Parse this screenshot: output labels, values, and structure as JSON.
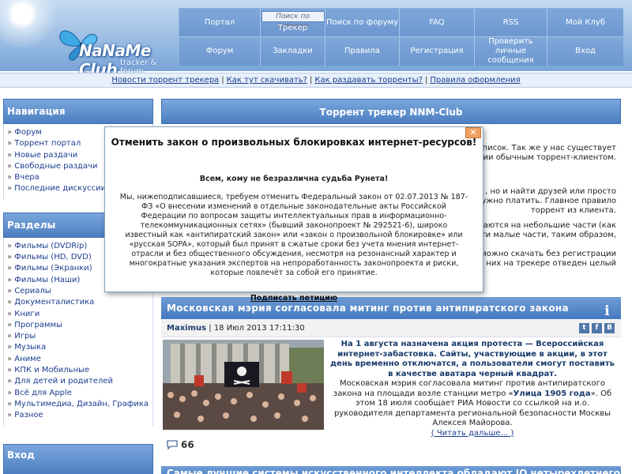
{
  "logo": {
    "name": "NaNaMe Club",
    "subtitle": "tracker & forum"
  },
  "nav": {
    "row1": [
      "Портал",
      "Трекер",
      "Поиск по форуму",
      "FAQ",
      "RSS",
      "Мой Клуб"
    ],
    "row2": [
      "Форум",
      "Закладки",
      "Правила",
      "Регистрация",
      "Проверить личные сообщения",
      "Вход"
    ],
    "search_placeholder": "Поиск по трекеру"
  },
  "linkbar": [
    "Новости торрент трекера",
    "Как тут скачивать?",
    "Как раздавать торренты?",
    "Правила оформления"
  ],
  "sidebar": {
    "nav_title": "Навигация",
    "nav_items": [
      "Форум",
      "Торрент портал",
      "Новые раздачи",
      "Свободные раздачи",
      "Вчера",
      "Последние дискуссии"
    ],
    "sections_title": "Разделы",
    "sections_items": [
      "Фильмы (DVDRip)",
      "Фильмы (HD, DVD)",
      "Фильмы (Экранки)",
      "Фильмы (Наши)",
      "Сериалы",
      "Документалистика",
      "Книги",
      "Программы",
      "Игры",
      "Музыка",
      "Аниме",
      "КПК и Мобильные",
      "Для детей и родителей",
      "Всё для Apple",
      "Мультимедиа, Дизайн, Графика",
      "Разное"
    ],
    "login_title": "Вход"
  },
  "main": {
    "title": "Торрент трекер NNM-Club",
    "lines": [
      "список. Так же у нас существует",
      "рации обычным торрент-клиентом.",
      "",
      ", но и найти друзей или просто",
      "не нужно платить. Главное правило",
      "торрент из клиента.",
      "",
      "разбиваются на небольшие части (как",
      "ают эти малые части, таким образом,",
      "",
      "можно скачать без регистрации",
      "од них на трекере отведен целый"
    ]
  },
  "news": {
    "title": "Московская мэрия согласовала митинг против антипиратского закона",
    "author": "Maximus",
    "date": "18 Июл 2013 17:11:30",
    "socials": [
      "t",
      "f",
      "B"
    ],
    "bold_text": "На 1 августа назначена акция протеста — Всероссийская интернет-забастовка. Сайты, участвующие в акции, в этот день временно отключатся, а пользователи смогут поставить в качестве аватара черный квадрат.",
    "text_before": "Московская мэрия согласовала митинг против антипиратского закона на площади возле станции метро «",
    "text_bold_inline": "Улица 1905 года",
    "text_after": "». Об этом 18 июля сообщает РИА Новости со ссылкой на и.о. руководителя департамента региональной безопасности Москвы Алексея Майорова.",
    "read_more": "( Читать дальше... )",
    "comments": "66",
    "next_title": "Самые лучшие системы искусственного интеллекта обладают IQ четырехлетнего"
  },
  "popup": {
    "title": "Отменить закон о произвольных блокировках интернет-ресурсов!",
    "lead": "Всем, кому не безразлична судьба Рунета!",
    "text": "Мы, нижеподписавшиеся, требуем отменить Федеральный закон от 02.07.2013 № 187-ФЗ «О внесении изменений в отдельные законодательные акты Российской Федерации по вопросам защиты интеллектуальных прав в информационно-телекоммуникационных сетях» (бывший законопроект № 292521-6), широко известный как «антипиратский закон» или «закон о произвольной блокировке» или «русская SOPA», который был принят в сжатые сроки без учета мнения интернет-отрасли и без общественного обсуждения, несмотря на резонансный характер и многократные указания экспертов на непроработанность законопроекта и риски, которые повлечёт за собой его принятие.",
    "sign": "Подписать петицию",
    "close": "✕"
  },
  "colors": {
    "header_blue": "#4c7fc2",
    "link": "#1a3d8f",
    "close_orange": "#f0a060"
  }
}
